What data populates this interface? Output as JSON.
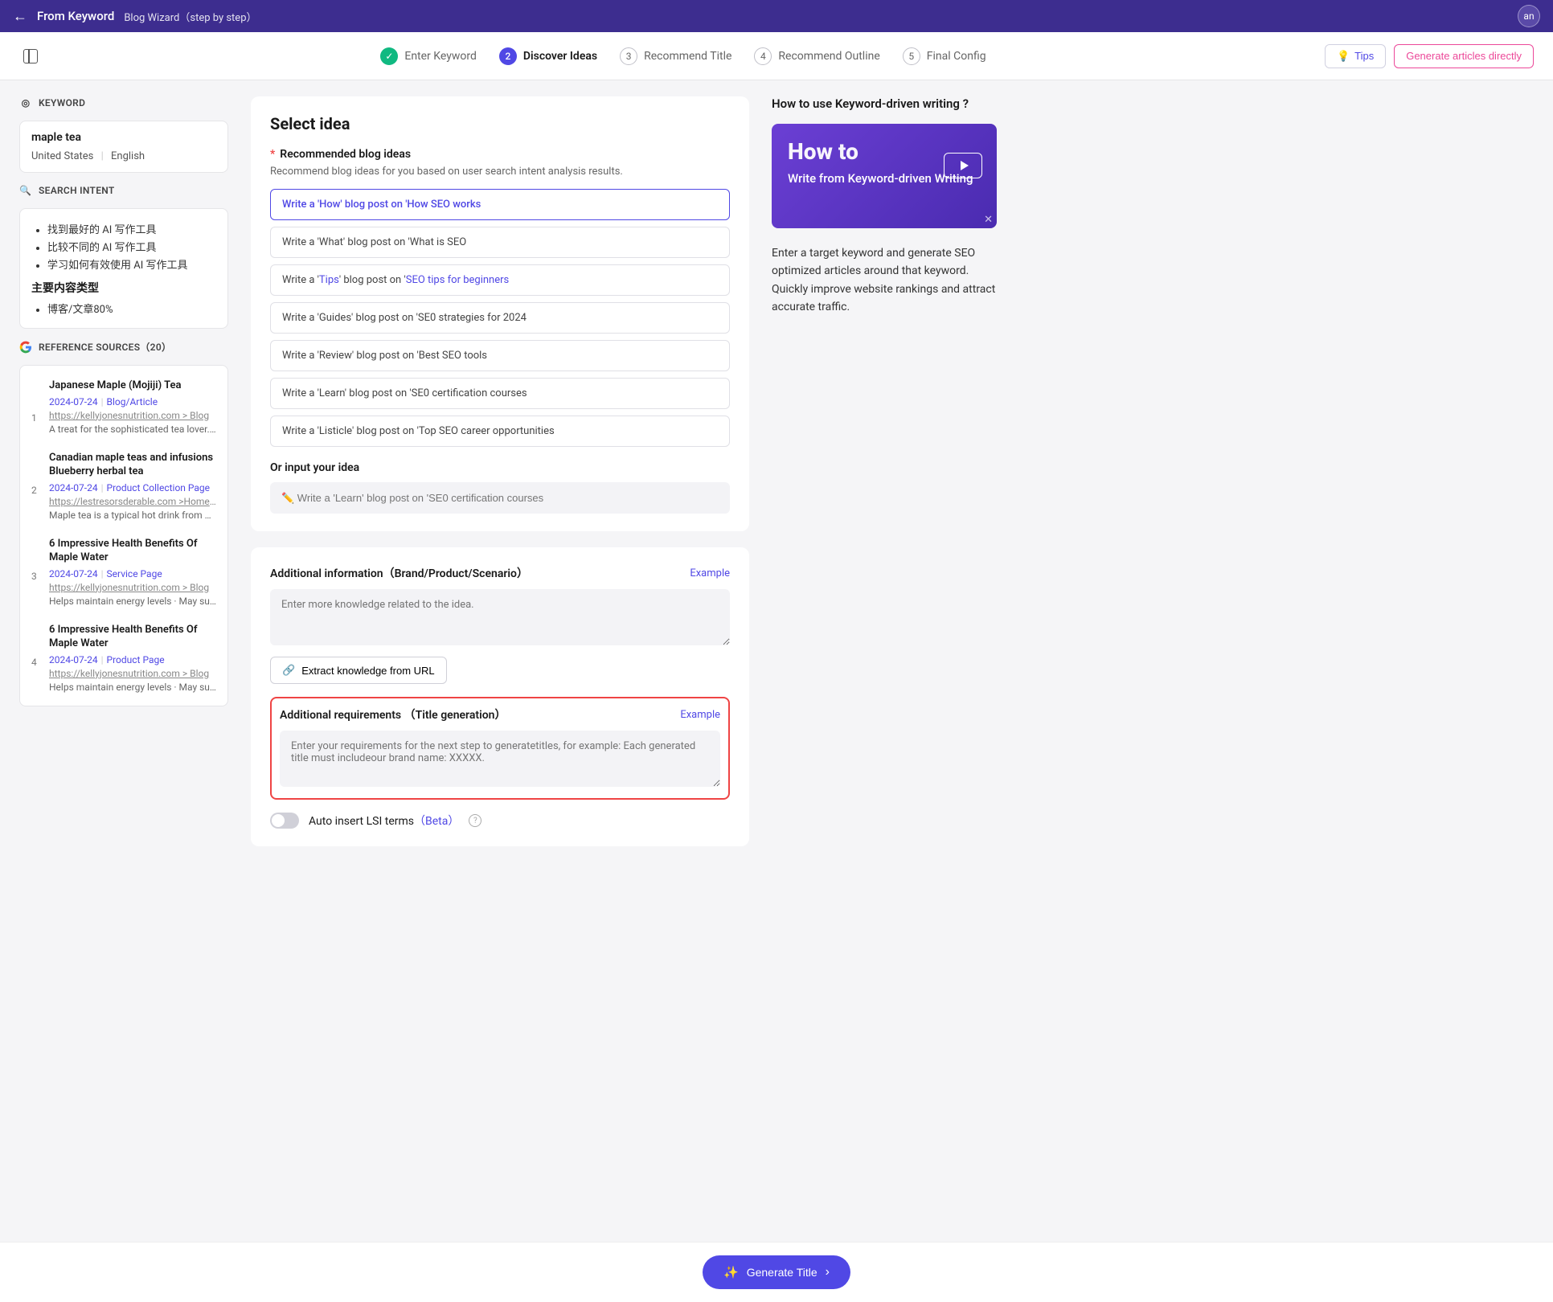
{
  "header": {
    "title": "From Keyword",
    "subtitle": "Blog Wizard（step by step）",
    "avatar_initials": "an"
  },
  "stepper": {
    "steps": [
      {
        "label": "Enter Keyword",
        "num": "✓"
      },
      {
        "label": "Discover Ideas",
        "num": "2"
      },
      {
        "label": "Recommend Title",
        "num": "3"
      },
      {
        "label": "Recommend Outline",
        "num": "4"
      },
      {
        "label": "Final Config",
        "num": "5"
      }
    ],
    "tips": "Tips",
    "generate_direct": "Generate articles directly"
  },
  "sidebar": {
    "keyword_header": "KEYWORD",
    "keyword_value": "maple tea",
    "country": "United States",
    "language": "English",
    "intent_header": "SEARCH INTENT",
    "intents": [
      "找到最好的 AI 写作工具",
      "比较不同的 AI 写作工具",
      "学习如何有效使用 AI 写作工具"
    ],
    "intent_content_heading": "主要内容类型",
    "intent_content_value": "博客/文章80%",
    "references_header": "REFERENCE SOURCES（20）",
    "references": [
      {
        "num": "1",
        "title": "Japanese Maple (Mojiji) Tea",
        "date": "2024-07-24",
        "type": "Blog/Article",
        "url": "https://kellyjonesnutrition.com > Blog",
        "desc": "A treat for the sophisticated tea lover. Ma..."
      },
      {
        "num": "2",
        "title": "Canadian maple teas and infusions Blueberry herbal tea",
        "date": "2024-07-24",
        "type": "Product Collection Page",
        "url": "https://lestresorsderable.com >Home >Drinks",
        "desc": "Maple tea is a typical hot drink from Cana..."
      },
      {
        "num": "3",
        "title": "6 Impressive Health Benefits Of Maple Water",
        "date": "2024-07-24",
        "type": "Service Page",
        "url": "https://kellyjonesnutrition.com > Blog",
        "desc": "Helps maintain energy levels · May suppo..."
      },
      {
        "num": "4",
        "title": "6 Impressive Health Benefits Of Maple Water",
        "date": "2024-07-24",
        "type": "Product Page",
        "url": "https://kellyjonesnutrition.com > Blog",
        "desc": "Helps maintain energy levels · May suppo..."
      }
    ]
  },
  "center": {
    "select_idea_title": "Select idea",
    "rec_label": "Recommended blog ideas",
    "rec_desc": "Recommend blog ideas for you based on user search intent analysis results.",
    "ideas": [
      "Write a 'How' blog post on 'How SEO works",
      "Write a 'What' blog post on 'What is SEO",
      "Write a 'Tips' blog post on 'SEO tips for beginners",
      "Write a 'Guides' blog post on 'SE0 strategies for 2024",
      "Write a 'Review' blog post on 'Best SEO tools",
      "Write a 'Learn' blog post on 'SE0 certification courses",
      "Write a 'Listicle' blog post on 'Top SEO career opportunities"
    ],
    "or_input_label": "Or input your idea",
    "or_input_placeholder": "✏️ Write a 'Learn' blog post on 'SE0 certification courses",
    "info_label": "Additional information（Brand/Product/Scenario）",
    "example_link": "Example",
    "info_placeholder": "Enter more knowledge related to the idea.",
    "extract_label": "Extract knowledge from URL",
    "req_label": "Additional requirements （Title generation）",
    "req_placeholder": "Enter your requirements for the next step to generatetitles, for example: Each generated title must includeour brand name: XXXXX.",
    "lsi_label": "Auto insert LSI terms",
    "lsi_beta": "（Beta）"
  },
  "right": {
    "title": "How to use Keyword-driven writing ?",
    "video_howto": "How to",
    "video_sub": "Write from Keyword-driven Writing",
    "desc": "Enter a target keyword and generate SEO optimized articles around that keyword. Quickly improve website rankings and attract accurate traffic."
  },
  "footer": {
    "generate": "Generate Title"
  }
}
